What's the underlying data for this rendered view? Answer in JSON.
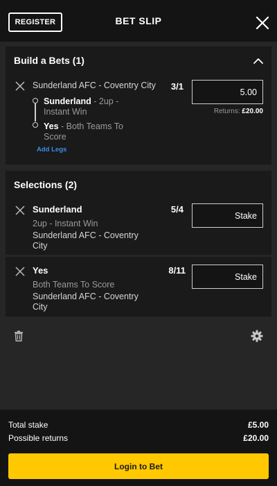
{
  "header": {
    "register_label": "REGISTER",
    "title": "BET SLIP"
  },
  "build_a_bets": {
    "title": "Build a Bets (1)",
    "match": "Sunderland AFC - Coventry City",
    "odds": "3/1",
    "stake_value": "5.00",
    "returns_label": "Returns:",
    "returns_value": "£20.00",
    "legs": [
      {
        "selection": "Sunderland",
        "market_line1": " - 2up -",
        "market_line2": "Instant Win"
      },
      {
        "selection": "Yes",
        "market_line1": " - Both Teams To",
        "market_line2": "Score"
      }
    ],
    "add_legs_label": "Add Legs"
  },
  "selections": {
    "title": "Selections (2)",
    "items": [
      {
        "selection": "Sunderland",
        "odds": "5/4",
        "market": "2up - Instant Win",
        "match_line1": "Sunderland AFC - Coventry",
        "match_line2": "City",
        "stake_placeholder": "Stake"
      },
      {
        "selection": "Yes",
        "odds": "8/11",
        "market": "Both Teams To Score",
        "match_line1": "Sunderland AFC - Coventry",
        "match_line2": "City",
        "stake_placeholder": "Stake"
      }
    ]
  },
  "footer": {
    "total_stake_label": "Total stake",
    "total_stake_value": "£5.00",
    "possible_returns_label": "Possible returns",
    "possible_returns_value": "£20.00",
    "login_label": "Login to Bet"
  },
  "colors": {
    "accent": "#ffc800",
    "link": "#3b8ee8",
    "card_bg": "#1a1a1a",
    "page_bg": "#262626"
  },
  "icons": [
    "close-icon",
    "chevron-up-icon",
    "remove-icon",
    "trash-icon",
    "gear-icon"
  ]
}
